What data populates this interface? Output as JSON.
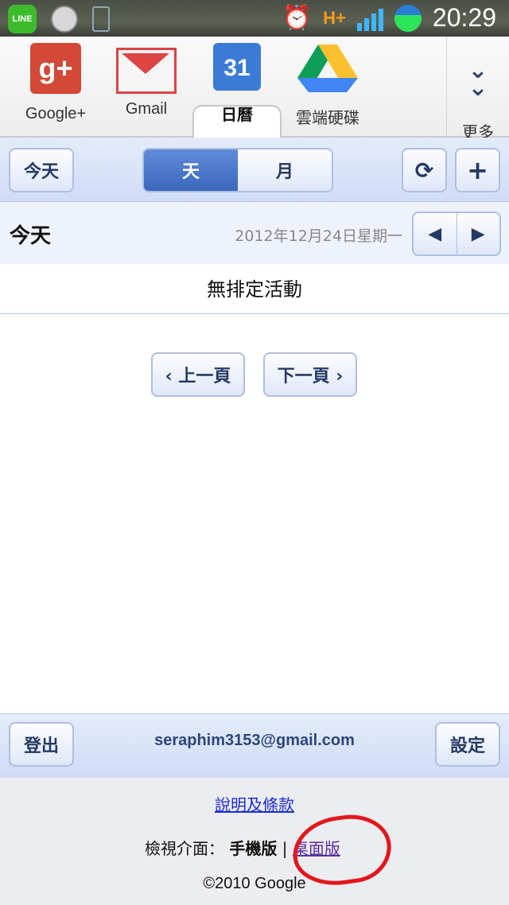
{
  "status_bar": {
    "line_label": "LINE",
    "time": "20:29",
    "network": "H+"
  },
  "apps": {
    "items": [
      {
        "label": "Google+",
        "icon": "google-plus-icon",
        "glyph": "g+"
      },
      {
        "label": "Gmail",
        "icon": "gmail-icon"
      },
      {
        "label": "日曆",
        "icon": "calendar-icon",
        "glyph": "31",
        "active": true
      },
      {
        "label": "雲端硬碟",
        "icon": "google-drive-icon"
      }
    ],
    "more_label": "更多"
  },
  "toolbar": {
    "today_label": "今天",
    "day_label": "天",
    "month_label": "月",
    "selected_view": "天",
    "refresh_glyph": "⟳",
    "add_glyph": "+"
  },
  "date_row": {
    "today_label": "今天",
    "date": "2012年12月24日星期一",
    "prev_glyph": "◀",
    "next_glyph": "▶"
  },
  "events": {
    "empty_text": "無排定活動"
  },
  "pagination": {
    "prev_label": "‹ 上一頁",
    "next_label": "下一頁 ›"
  },
  "bottom_bar": {
    "logout_label": "登出",
    "email": "seraphim3153@gmail.com",
    "settings_label": "設定"
  },
  "footer": {
    "help_link": "說明及條款",
    "view_prefix": "檢視介面：",
    "mobile_label": "手機版",
    "separator": "|",
    "desktop_link": "桌面版",
    "copyright": "©2010 Google"
  },
  "colors": {
    "accent": "#3a67bc",
    "toolbar_bg": "#dbe5f8",
    "annotation": "#e3161a"
  }
}
